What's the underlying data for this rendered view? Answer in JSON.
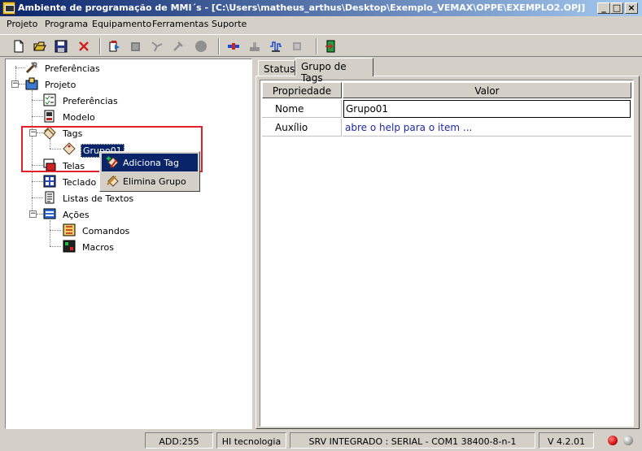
{
  "window": {
    "title": "Ambiente de programação de MMI´s - [C:\\Users\\matheus_arthus\\Desktop\\Exemplo_VEMAX\\OPPE\\EXEMPLO2.OPJ]",
    "minimize": "_",
    "maximize": "□",
    "close": "×"
  },
  "menu": [
    "Projeto",
    "Programa",
    "Equipamento",
    "Ferramentas",
    "Suporte"
  ],
  "tree": {
    "preferencias_root": "Preferências",
    "projeto": "Projeto",
    "preferencias": "Preferências",
    "modelo": "Modelo",
    "tags": "Tags",
    "grupo01": "Grupo01",
    "telas": "Telas",
    "teclado": "Teclado",
    "listas_textos": "Listas de Textos",
    "acoes": "Ações",
    "comandos": "Comandos",
    "macros": "Macros",
    "expand_minus": "−"
  },
  "context_menu": {
    "adiciona_tag": "Adiciona Tag",
    "elimina_grupo": "Elimina Grupo"
  },
  "tabs": [
    "Status",
    "Grupo de Tags"
  ],
  "grid": {
    "headers": [
      "Propriedade",
      "Valor"
    ],
    "rows": [
      {
        "prop": "Nome",
        "value": "Grupo01"
      },
      {
        "prop": "Auxílio",
        "value": "abre o help para o item ..."
      }
    ]
  },
  "statusbar": {
    "add": "ADD:255",
    "company": "HI tecnologia",
    "server": "SRV INTEGRADO : SERIAL - COM1 38400-8-n-1",
    "version": "V 4.2.01"
  },
  "colors": {
    "title_active": "#0a246a",
    "highlight_box": "#e0202a",
    "link_blue": "#1e2aa0",
    "led_red": "#d01010",
    "led_gray": "#a0a0a0"
  }
}
